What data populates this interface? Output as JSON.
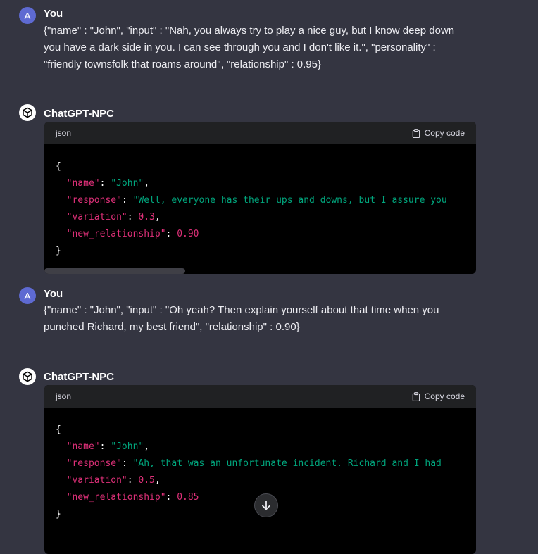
{
  "messages": [
    {
      "author": "You",
      "avatar_letter": "A",
      "text_lines": [
        "{\"name\" : \"John\",  \"input\" : \"Nah, you always try to play a nice guy, but I know deep down",
        "you have a dark side in you. I can see through you and I don't like it.\", \"personality\" :",
        "\"friendly townsfolk that roams around\", \"relationship\" : 0.95}"
      ]
    },
    {
      "author": "ChatGPT-NPC",
      "code_lang": "json",
      "copy_label": "Copy code",
      "code": {
        "open": "{",
        "name_key": "\"name\"",
        "name_val": "\"John\"",
        "response_key": "\"response\"",
        "response_val": "\"Well, everyone has their ups and downs, but I assure you",
        "variation_key": "\"variation\"",
        "variation_val": "0.3",
        "relationship_key": "\"new_relationship\"",
        "relationship_val": "0.90",
        "close": "}"
      }
    },
    {
      "author": "You",
      "avatar_letter": "A",
      "text_lines": [
        "{\"name\" : \"John\",  \"input\" : \"Oh yeah? Then explain yourself about that time when you",
        "punched Richard, my best friend\", \"relationship\" : 0.90}"
      ]
    },
    {
      "author": "ChatGPT-NPC",
      "code_lang": "json",
      "copy_label": "Copy code",
      "code": {
        "open": "{",
        "name_key": "\"name\"",
        "name_val": "\"John\"",
        "response_key": "\"response\"",
        "response_val": "\"Ah, that was an unfortunate incident. Richard and I had",
        "variation_key": "\"variation\"",
        "variation_val": "0.5",
        "relationship_key": "\"new_relationship\"",
        "relationship_val": "0.85",
        "close": "}"
      }
    }
  ],
  "icons": {
    "bot_avatar": "openai-logo-icon",
    "copy": "clipboard-icon",
    "scroll_down": "arrow-down-icon"
  }
}
